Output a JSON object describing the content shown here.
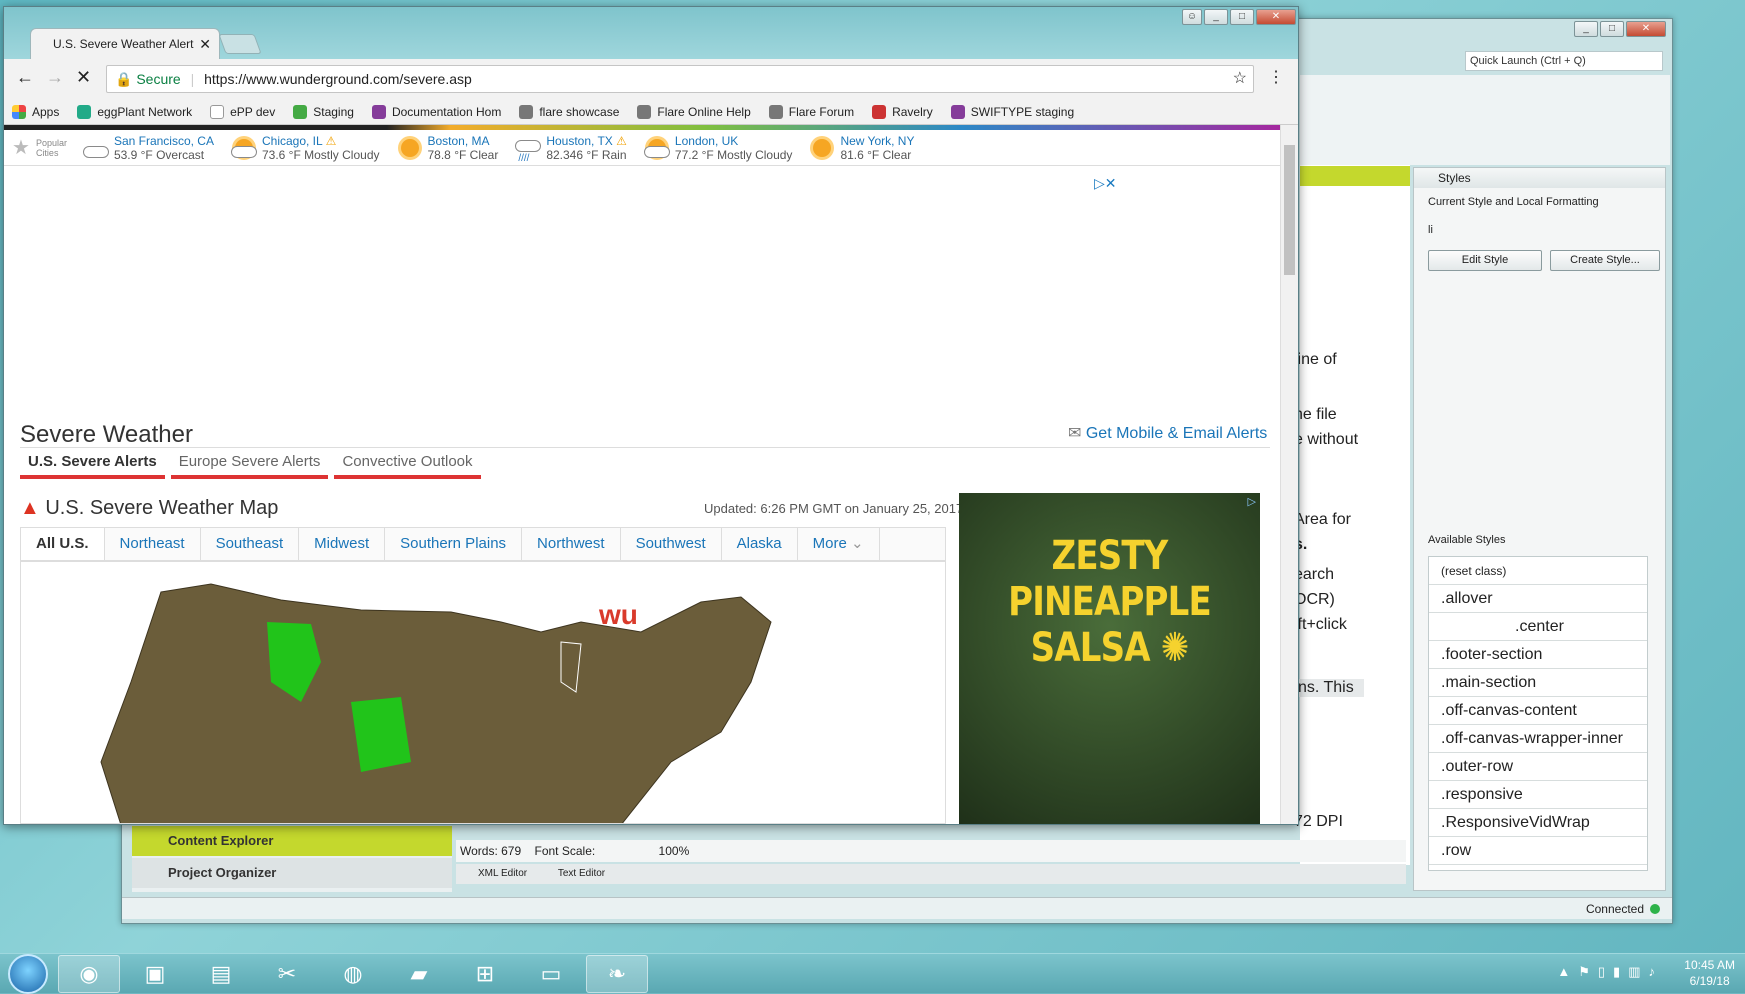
{
  "chrome": {
    "tab_title": "U.S. Severe Weather Alert",
    "secure_label": "Secure",
    "url": "https://www.wunderground.com/severe.asp",
    "bookmarks": [
      "Apps",
      "eggPlant Network",
      "ePP dev",
      "Staging",
      "Documentation Hom",
      "flare showcase",
      "Flare Online Help",
      "Flare Forum",
      "Ravelry",
      "SWIFTYPE staging"
    ]
  },
  "page": {
    "popular_label": "Popular Cities",
    "cities": [
      {
        "name": "San Francisco, CA",
        "cond": "53.9 °F Overcast",
        "icon": "cloud"
      },
      {
        "name": "Chicago, IL",
        "cond": "73.6 °F Mostly Cloudy",
        "icon": "partly-cloudy"
      },
      {
        "name": "Boston, MA",
        "cond": "78.8 °F Clear",
        "icon": "sun"
      },
      {
        "name": "Houston, TX",
        "cond": "82.346 °F Rain",
        "icon": "rain"
      },
      {
        "name": "London, UK",
        "cond": "77.2 °F Mostly Cloudy",
        "icon": "partly-cloudy"
      },
      {
        "name": "New York, NY",
        "cond": "81.6 °F Clear",
        "icon": "sun"
      }
    ],
    "title": "Severe Weather",
    "alerts_link": "Get Mobile & Email Alerts",
    "subtabs": [
      "U.S. Severe Alerts",
      "Europe Severe Alerts",
      "Convective Outlook"
    ],
    "map_title": "U.S. Severe Weather Map",
    "updated": "Updated: 6:26 PM GMT on January 25, 2017",
    "regions": [
      "All U.S.",
      "Northeast",
      "Southeast",
      "Midwest",
      "Southern Plains",
      "Northwest",
      "Southwest",
      "Alaska",
      "More"
    ],
    "ad_text_1": "ZESTY PINEAPPLE",
    "ad_text_2": "SALSA",
    "wu_logo": "wu"
  },
  "flare": {
    "quick_launch": "Quick Launch (Ctrl + Q)",
    "styles_title": "Styles",
    "current_style_label": "Current Style and Local Formatting",
    "current_style_value": "li",
    "edit_style": "Edit Style",
    "create_style": "Create Style...",
    "available_styles_label": "Available Styles",
    "styles": [
      "(reset class)",
      ".allover",
      ".center",
      ".footer-section",
      ".main-section",
      ".off-canvas-content",
      ".off-canvas-wrapper-inner",
      ".outer-row",
      ".responsive",
      ".ResponsiveVidWrap",
      ".row"
    ],
    "doc_fragments": [
      "line of",
      "he file",
      "e without",
      "Area for",
      "s.",
      "earch",
      "OCR)",
      "ift+click",
      "ns. This",
      "72 DPI"
    ],
    "content_explorer": "Content Explorer",
    "project_organizer": "Project Organizer",
    "words": "Words: 679",
    "font_scale": "Font Scale:",
    "zoom": "100%",
    "xml_editor": "XML Editor",
    "text_editor": "Text Editor",
    "connected": "Connected"
  },
  "taskbar": {
    "time": "10:45 AM",
    "date": "6/19/18"
  }
}
